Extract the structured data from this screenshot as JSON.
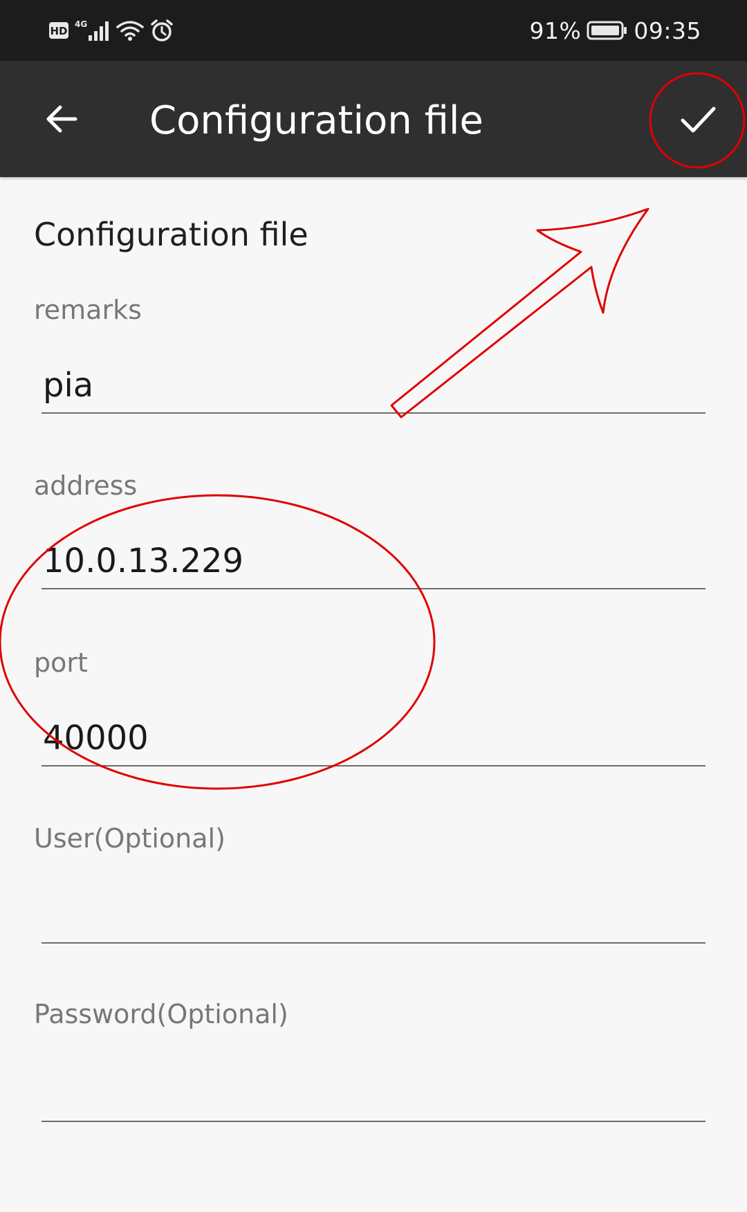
{
  "status_bar": {
    "indicators": [
      "hd-icon",
      "4g-signal-icon",
      "wifi-icon",
      "alarm-icon"
    ],
    "battery_percent": "91%",
    "time": "09:35"
  },
  "app_bar": {
    "back_icon": "arrow-left-icon",
    "title": "Configuration file",
    "confirm_icon": "check-icon"
  },
  "form": {
    "section_title": "Configuration file",
    "fields": [
      {
        "label": "remarks",
        "value": "pia"
      },
      {
        "label": "address",
        "value": "10.0.13.229"
      },
      {
        "label": "port",
        "value": "40000"
      },
      {
        "label": "User(Optional)",
        "value": ""
      },
      {
        "label": "Password(Optional)",
        "value": ""
      }
    ]
  },
  "annotations": {
    "color": "#e00000",
    "shapes": [
      "circle-around-confirm-button",
      "arrow-to-confirm-button",
      "ellipse-around-address-and-port"
    ]
  }
}
